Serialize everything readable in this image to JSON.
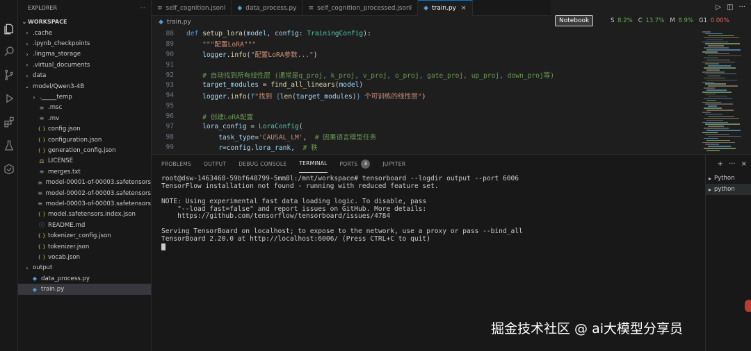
{
  "explorer": {
    "title": "EXPLORER",
    "workspace": "WORKSPACE",
    "items": [
      {
        "label": ".cache",
        "kind": "folder",
        "depth": 1,
        "chev": "›"
      },
      {
        "label": ".ipynb_checkpoints",
        "kind": "folder",
        "depth": 1,
        "chev": "›"
      },
      {
        "label": ".lingma_storage",
        "kind": "folder",
        "depth": 1,
        "chev": "›"
      },
      {
        "label": ".virtual_documents",
        "kind": "folder",
        "depth": 1,
        "chev": "›"
      },
      {
        "label": "data",
        "kind": "folder",
        "depth": 1,
        "chev": "›"
      },
      {
        "label": "model/Qwen3-4B",
        "kind": "folder",
        "depth": 1,
        "chev": "⌄"
      },
      {
        "label": "._____temp",
        "kind": "folder",
        "depth": 2,
        "chev": "›"
      },
      {
        "label": ".msc",
        "kind": "file-lines",
        "depth": 2,
        "chev": ""
      },
      {
        "label": ".mv",
        "kind": "file-lines",
        "depth": 2,
        "chev": ""
      },
      {
        "label": "config.json",
        "kind": "json",
        "depth": 2,
        "chev": ""
      },
      {
        "label": "configuration.json",
        "kind": "json",
        "depth": 2,
        "chev": ""
      },
      {
        "label": "generation_config.json",
        "kind": "json",
        "depth": 2,
        "chev": ""
      },
      {
        "label": "LICENSE",
        "kind": "license",
        "depth": 2,
        "chev": ""
      },
      {
        "label": "merges.txt",
        "kind": "file-lines",
        "depth": 2,
        "chev": ""
      },
      {
        "label": "model-00001-of-00003.safetensors",
        "kind": "file-lines",
        "depth": 2,
        "chev": ""
      },
      {
        "label": "model-00002-of-00003.safetensors",
        "kind": "file-lines",
        "depth": 2,
        "chev": ""
      },
      {
        "label": "model-00003-of-00003.safetensors",
        "kind": "file-lines",
        "depth": 2,
        "chev": ""
      },
      {
        "label": "model.safetensors.index.json",
        "kind": "json",
        "depth": 2,
        "chev": ""
      },
      {
        "label": "README.md",
        "kind": "info",
        "depth": 2,
        "chev": ""
      },
      {
        "label": "tokenizer_config.json",
        "kind": "json",
        "depth": 2,
        "chev": ""
      },
      {
        "label": "tokenizer.json",
        "kind": "json",
        "depth": 2,
        "chev": ""
      },
      {
        "label": "vocab.json",
        "kind": "json",
        "depth": 2,
        "chev": ""
      },
      {
        "label": "output",
        "kind": "folder",
        "depth": 1,
        "chev": "›"
      },
      {
        "label": "data_process.py",
        "kind": "python",
        "depth": 1,
        "chev": ""
      },
      {
        "label": "train.py",
        "kind": "python",
        "depth": 1,
        "chev": "",
        "active": true
      }
    ]
  },
  "tabs": [
    {
      "label": "self_cognition.jsonl",
      "icon": "≡",
      "active": false
    },
    {
      "label": "data_process.py",
      "icon": "◆",
      "active": false
    },
    {
      "label": "self_cognition_processed.jsonl",
      "icon": "≡",
      "active": false
    },
    {
      "label": "train.py",
      "icon": "◆",
      "active": true,
      "close": "×"
    }
  ],
  "breadcrumb": "train.py",
  "toolbar": {
    "notebook_label": "Notebook",
    "stats": [
      {
        "label": "S",
        "value": "8.2%",
        "color": "#6aa84f"
      },
      {
        "label": "C",
        "value": "13.7%",
        "color": "#6aa84f"
      },
      {
        "label": "M",
        "value": "8.9%",
        "color": "#6aa84f"
      },
      {
        "label": "G1",
        "value": "0.00%",
        "color": "#e06666"
      }
    ]
  },
  "code": [
    {
      "n": "88",
      "parts": [
        [
          "kw",
          "def "
        ],
        [
          "fn",
          "setup_lora"
        ],
        [
          "",
          "("
        ],
        [
          "vr",
          "model"
        ],
        [
          "",
          ", "
        ],
        [
          "vr",
          "config"
        ],
        [
          "",
          ": "
        ],
        [
          "cl",
          "TrainingConfig"
        ],
        [
          "",
          "):"
        ]
      ]
    },
    {
      "n": "89",
      "parts": [
        [
          "",
          "    "
        ],
        [
          "str",
          "\"\"\"配置LoRA\"\"\""
        ]
      ]
    },
    {
      "n": "90",
      "parts": [
        [
          "",
          "    "
        ],
        [
          "vr",
          "logger"
        ],
        [
          "",
          "."
        ],
        [
          "fn",
          "info"
        ],
        [
          "",
          "("
        ],
        [
          "str",
          "\"配置LoRA参数...\""
        ],
        [
          "",
          ")"
        ]
      ]
    },
    {
      "n": "91",
      "parts": [
        [
          "",
          ""
        ]
      ]
    },
    {
      "n": "92",
      "parts": [
        [
          "",
          "    "
        ],
        [
          "cm",
          "# 自动找到所有线性层 (通常是q_proj, k_proj, v_proj, o_proj, gate_proj, up_proj, down_proj等)"
        ]
      ]
    },
    {
      "n": "93",
      "parts": [
        [
          "",
          "    "
        ],
        [
          "vr",
          "target_modules"
        ],
        [
          "",
          " = "
        ],
        [
          "fn",
          "find_all_linears"
        ],
        [
          "",
          "("
        ],
        [
          "vr",
          "model"
        ],
        [
          "",
          ")"
        ]
      ]
    },
    {
      "n": "94",
      "parts": [
        [
          "",
          "    "
        ],
        [
          "vr",
          "logger"
        ],
        [
          "",
          "."
        ],
        [
          "fn",
          "info"
        ],
        [
          "",
          "("
        ],
        [
          "kw",
          "f"
        ],
        [
          "str",
          "\"找到 "
        ],
        [
          "kw",
          "{"
        ],
        [
          "fn",
          "len"
        ],
        [
          "",
          "("
        ],
        [
          "vr",
          "target_modules"
        ],
        [
          "",
          ")"
        ],
        [
          "kw",
          "}"
        ],
        [
          "str",
          " 个可训练的线性层\""
        ],
        [
          "",
          ")"
        ]
      ]
    },
    {
      "n": "95",
      "parts": [
        [
          "",
          ""
        ]
      ]
    },
    {
      "n": "96",
      "parts": [
        [
          "",
          "    "
        ],
        [
          "cm",
          "# 创建LoRA配置"
        ]
      ]
    },
    {
      "n": "97",
      "parts": [
        [
          "",
          "    "
        ],
        [
          "vr",
          "lora_config"
        ],
        [
          "",
          " = "
        ],
        [
          "cl",
          "LoraConfig"
        ],
        [
          "",
          "("
        ]
      ]
    },
    {
      "n": "98",
      "parts": [
        [
          "",
          "        "
        ],
        [
          "vr",
          "task_type"
        ],
        [
          "",
          "="
        ],
        [
          "str",
          "'CAUSAL_LM'"
        ],
        [
          "",
          ",  "
        ],
        [
          "cm",
          "# 因果语言模型任务"
        ]
      ]
    },
    {
      "n": "99",
      "parts": [
        [
          "",
          "        "
        ],
        [
          "vr",
          "r"
        ],
        [
          "",
          "="
        ],
        [
          "vr",
          "config"
        ],
        [
          "",
          "."
        ],
        [
          "vr",
          "lora_rank"
        ],
        [
          "",
          ",  "
        ],
        [
          "cm",
          "# 秩"
        ]
      ]
    }
  ],
  "panel": {
    "tabs": [
      {
        "label": "PROBLEMS",
        "active": false
      },
      {
        "label": "OUTPUT",
        "active": false
      },
      {
        "label": "DEBUG CONSOLE",
        "active": false
      },
      {
        "label": "TERMINAL",
        "active": true
      },
      {
        "label": "PORTS",
        "active": false,
        "badge": "3"
      },
      {
        "label": "JUPYTER",
        "active": false
      }
    ],
    "terminal_lines": [
      "root@dsw-1463468-59bf648799-5mm8l:/mnt/workspace# tensorboard --logdir output --port 6006",
      "TensorFlow installation not found - running with reduced feature set.",
      "",
      "NOTE: Using experimental fast data loading logic. To disable, pass",
      "    \"--load_fast=false\" and report issues on GitHub. More details:",
      "    https://github.com/tensorflow/tensorboard/issues/4784",
      "",
      "Serving TensorBoard on localhost; to expose to the network, use a proxy or pass --bind_all",
      "TensorBoard 2.20.0 at http://localhost:6006/ (Press CTRL+C to quit)"
    ],
    "sessions": [
      {
        "label": "Python",
        "active": false
      },
      {
        "label": "python",
        "active": true
      }
    ]
  },
  "watermark": "掘金技术社区 @ ai大模型分享员"
}
